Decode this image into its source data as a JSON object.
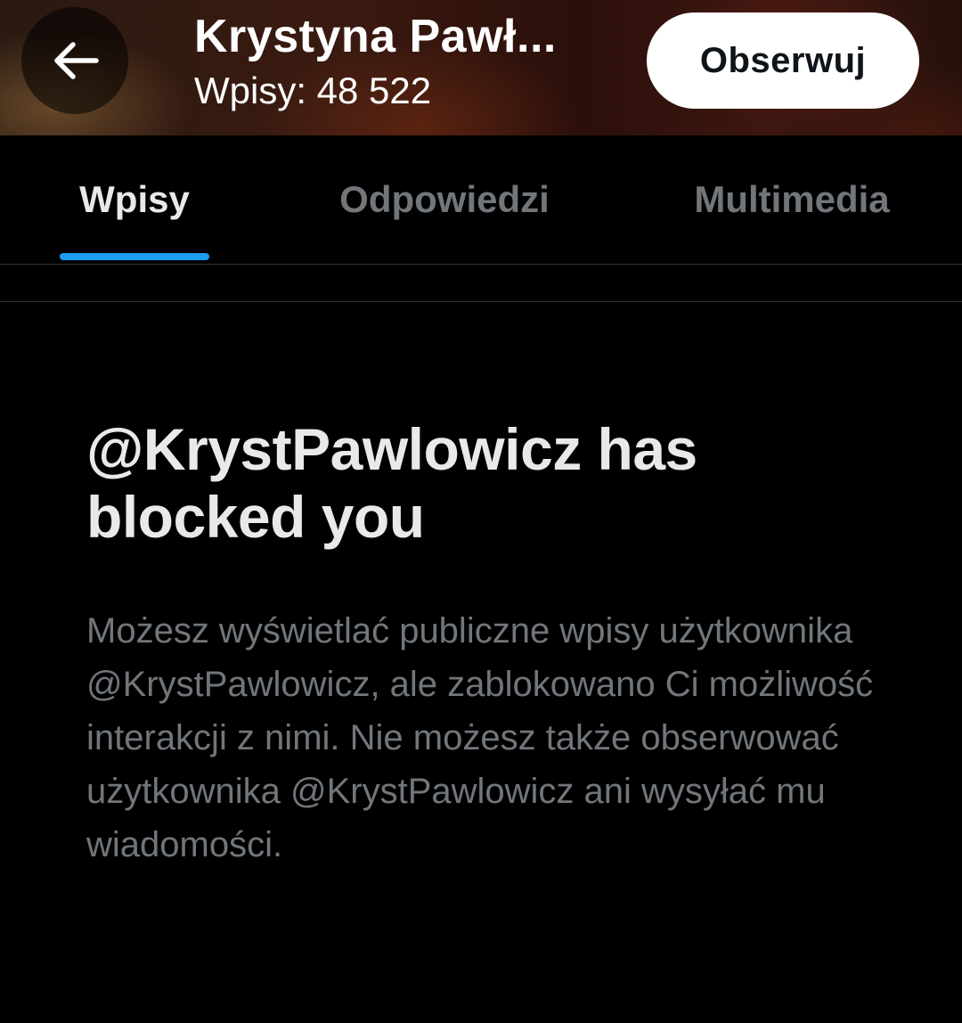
{
  "header": {
    "back_icon": "arrow-left-icon",
    "profile_name": "Krystyna Pawł...",
    "post_count": "Wpisy: 48 522",
    "follow_label": "Obserwuj"
  },
  "tabs": [
    {
      "label": "Wpisy",
      "active": true
    },
    {
      "label": "Odpowiedzi",
      "active": false
    },
    {
      "label": "Multimedia",
      "active": false
    }
  ],
  "blocked_notice": {
    "title": "@KrystPawlowicz has blocked you",
    "description": "Możesz wyświetlać publiczne wpisy użytkownika @KrystPawlowicz, ale zablokowano Ci możliwość interakcji z nimi. Nie możesz także obserwować użytkownika @KrystPawlowicz ani wysyłać mu wiadomości."
  },
  "colors": {
    "background": "#000000",
    "primary_text": "#e7e9ea",
    "secondary_text": "#71767b",
    "accent": "#1d9bf0",
    "divider": "#2f3336"
  }
}
